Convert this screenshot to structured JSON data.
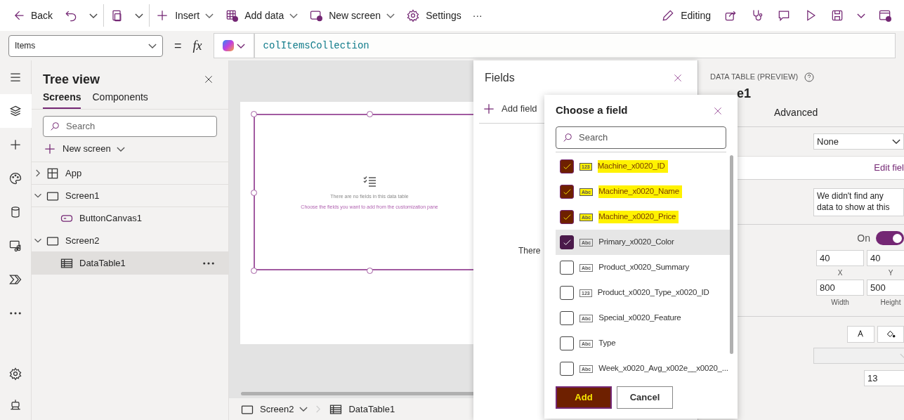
{
  "toolbar": {
    "left": [
      {
        "kind": "back",
        "label": "Back"
      },
      {
        "kind": "undo"
      },
      {
        "kind": "caret"
      },
      {
        "kind": "paste"
      },
      {
        "kind": "caret"
      },
      {
        "kind": "plus",
        "label": "Insert",
        "caret": true
      },
      {
        "kind": "table-add",
        "label": "Add data",
        "caret": true
      },
      {
        "kind": "screen-add",
        "label": "New screen",
        "caret": true
      },
      {
        "kind": "gear",
        "label": "Settings"
      },
      {
        "kind": "more",
        "label": "···"
      }
    ],
    "right": [
      {
        "kind": "pencil",
        "label": "Editing"
      },
      {
        "kind": "share"
      },
      {
        "kind": "stethoscope"
      },
      {
        "kind": "comment"
      },
      {
        "kind": "play"
      },
      {
        "kind": "save"
      },
      {
        "kind": "caret"
      },
      {
        "kind": "publish"
      }
    ]
  },
  "formula": {
    "property": "Items",
    "equals": "=",
    "fx": "fx",
    "value": "colItemsCollection"
  },
  "rail": [
    {
      "kind": "menu",
      "selected": false
    },
    {
      "kind": "layers",
      "selected": true
    },
    {
      "kind": "plus",
      "selected": false
    },
    {
      "kind": "palette",
      "selected": false
    },
    {
      "kind": "database",
      "selected": false
    },
    {
      "kind": "media",
      "selected": false
    },
    {
      "kind": "flow",
      "selected": false
    },
    {
      "kind": "more",
      "selected": false
    }
  ],
  "rail_bottom": [
    {
      "kind": "gear"
    },
    {
      "kind": "bot"
    }
  ],
  "tree": {
    "title": "Tree view",
    "tabs": [
      {
        "label": "Screens",
        "selected": true
      },
      {
        "label": "Components",
        "selected": false
      }
    ],
    "search": {
      "placeholder": "Search"
    },
    "new_screen": "New screen",
    "nodes": [
      {
        "kind": "app",
        "label": "App",
        "expanded": false,
        "selected": false
      },
      {
        "kind": "screen",
        "label": "Screen1",
        "expanded": true,
        "selected": false,
        "children": [
          {
            "kind": "button",
            "label": "ButtonCanvas1",
            "selected": false
          }
        ]
      },
      {
        "kind": "screen",
        "label": "Screen2",
        "expanded": true,
        "selected": false,
        "children": [
          {
            "kind": "table",
            "label": "DataTable1",
            "selected": true
          }
        ]
      }
    ]
  },
  "canvas": {
    "empty_title": "There are no fields in this data table",
    "empty_hint": "Choose the fields you want to add from the customization pane"
  },
  "breadcrumb": [
    {
      "kind": "screen",
      "label": "Screen2"
    },
    {
      "kind": "table",
      "label": "DataTable1"
    }
  ],
  "fields_panel": {
    "title": "Fields",
    "add_field": "Add field",
    "body_text": "There"
  },
  "chooser": {
    "title": "Choose a field",
    "search": {
      "placeholder": "Search"
    },
    "fields": [
      {
        "type": "123",
        "name": "Machine_x0020_ID",
        "checked": true,
        "highlighted": true,
        "selected": false
      },
      {
        "type": "Abc",
        "name": "Machine_x0020_Name",
        "checked": true,
        "highlighted": true,
        "selected": false
      },
      {
        "type": "Abc",
        "name": "Machine_x0020_Price",
        "checked": true,
        "highlighted": true,
        "selected": false
      },
      {
        "type": "Abc",
        "name": "Primary_x0020_Color",
        "checked": true,
        "highlighted": false,
        "selected": true
      },
      {
        "type": "Abc",
        "name": "Product_x0020_Summary",
        "checked": false,
        "highlighted": false,
        "selected": false
      },
      {
        "type": "123",
        "name": "Product_x0020_Type_x0020_ID",
        "checked": false,
        "highlighted": false,
        "selected": false
      },
      {
        "type": "Abc",
        "name": "Special_x0020_Feature",
        "checked": false,
        "highlighted": false,
        "selected": false
      },
      {
        "type": "Abc",
        "name": "Type",
        "checked": false,
        "highlighted": false,
        "selected": false
      },
      {
        "type": "Abc",
        "name": "Week_x0020_Avg_x002e__x0020_...",
        "checked": false,
        "highlighted": false,
        "selected": false
      }
    ],
    "add_button": {
      "label": "Add",
      "highlighted": true
    },
    "cancel_button": {
      "label": "Cancel"
    }
  },
  "properties": {
    "header": "DATA TABLE (PREVIEW)",
    "name": "e1",
    "tab": "Advanced",
    "dropdown": "None",
    "edit_fields": "Edit fiel",
    "no_data_text": "We didn't find any data to show at this",
    "toggle": {
      "label": "On",
      "on": true
    },
    "position": [
      {
        "value": "40",
        "label": "X"
      },
      {
        "value": "40",
        "label": "Y"
      }
    ],
    "size": [
      {
        "value": "800",
        "label": "Width"
      },
      {
        "value": "500",
        "label": "Height"
      }
    ],
    "font_size": "13"
  }
}
